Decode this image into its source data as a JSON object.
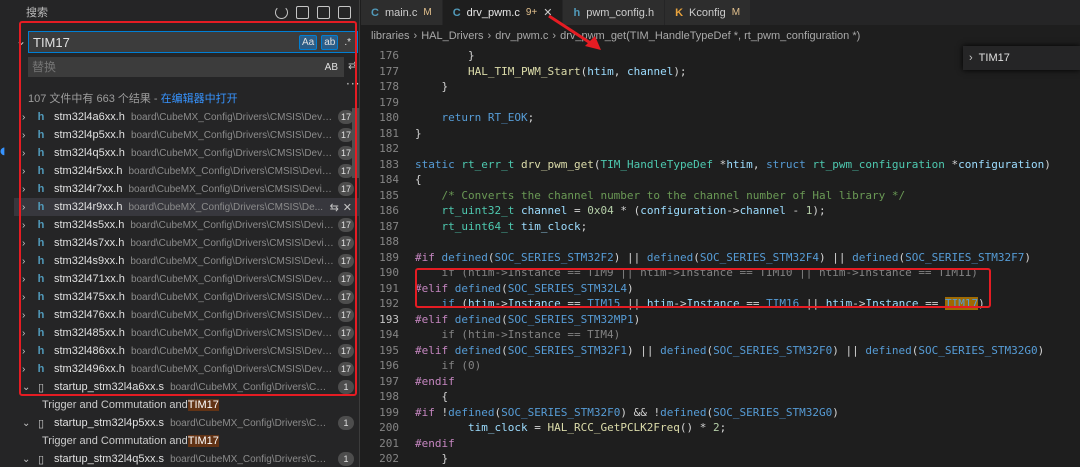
{
  "sidebar": {
    "title": "搜索",
    "search_value": "TIM17",
    "opt_case": "Aa",
    "opt_word": "ab",
    "opt_regex": ".*",
    "replace_placeholder": "替换",
    "opt_preserve_case": "AB",
    "summary": "107 文件中有 663 个结果 - ",
    "open_in_editor": "在编辑器中打开",
    "results": [
      {
        "name": "stm32l4a6xx.h",
        "path": "board\\CubeMX_Config\\Drivers\\CMSIS\\Device\\...",
        "count": "17",
        "icon": "h"
      },
      {
        "name": "stm32l4p5xx.h",
        "path": "board\\CubeMX_Config\\Drivers\\CMSIS\\Device\\...",
        "count": "17",
        "icon": "h"
      },
      {
        "name": "stm32l4q5xx.h",
        "path": "board\\CubeMX_Config\\Drivers\\CMSIS\\Device\\...",
        "count": "17",
        "icon": "h"
      },
      {
        "name": "stm32l4r5xx.h",
        "path": "board\\CubeMX_Config\\Drivers\\CMSIS\\Device\\...",
        "count": "17",
        "icon": "h"
      },
      {
        "name": "stm32l4r7xx.h",
        "path": "board\\CubeMX_Config\\Drivers\\CMSIS\\Device\\...",
        "count": "17",
        "icon": "h"
      },
      {
        "name": "stm32l4r9xx.h",
        "path": "board\\CubeMX_Config\\Drivers\\CMSIS\\De...",
        "count": "",
        "icon": "h"
      },
      {
        "name": "stm32l4s5xx.h",
        "path": "board\\CubeMX_Config\\Drivers\\CMSIS\\Device\\...",
        "count": "17",
        "icon": "h"
      },
      {
        "name": "stm32l4s7xx.h",
        "path": "board\\CubeMX_Config\\Drivers\\CMSIS\\Device\\...",
        "count": "17",
        "icon": "h"
      },
      {
        "name": "stm32l4s9xx.h",
        "path": "board\\CubeMX_Config\\Drivers\\CMSIS\\Device\\...",
        "count": "17",
        "icon": "h"
      },
      {
        "name": "stm32l471xx.h",
        "path": "board\\CubeMX_Config\\Drivers\\CMSIS\\Device\\...",
        "count": "17",
        "icon": "h"
      },
      {
        "name": "stm32l475xx.h",
        "path": "board\\CubeMX_Config\\Drivers\\CMSIS\\Device\\...",
        "count": "17",
        "icon": "h"
      },
      {
        "name": "stm32l476xx.h",
        "path": "board\\CubeMX_Config\\Drivers\\CMSIS\\Device\\...",
        "count": "17",
        "icon": "h"
      },
      {
        "name": "stm32l485xx.h",
        "path": "board\\CubeMX_Config\\Drivers\\CMSIS\\Device\\...",
        "count": "17",
        "icon": "h"
      },
      {
        "name": "stm32l486xx.h",
        "path": "board\\CubeMX_Config\\Drivers\\CMSIS\\Device\\...",
        "count": "17",
        "icon": "h"
      },
      {
        "name": "stm32l496xx.h",
        "path": "board\\CubeMX_Config\\Drivers\\CMSIS\\Device\\...",
        "count": "17",
        "icon": "h"
      }
    ],
    "results_s": [
      {
        "name": "startup_stm32l4a6xx.s",
        "path": "board\\CubeMX_Config\\Drivers\\CMSIS\\...",
        "count": "1",
        "match_pre": "Trigger and Commutation and ",
        "match_hl": "TIM17"
      },
      {
        "name": "startup_stm32l4p5xx.s",
        "path": "board\\CubeMX_Config\\Drivers\\CMSIS...",
        "count": "1",
        "match_pre": "Trigger and Commutation and ",
        "match_hl": "TIM17"
      },
      {
        "name": "startup_stm32l4q5xx.s",
        "path": "board\\CubeMX_Config\\Drivers\\CMSIS...",
        "count": "1"
      }
    ]
  },
  "editor": {
    "tabs": [
      {
        "icon": "C",
        "label": "main.c",
        "mod": "M",
        "close": ""
      },
      {
        "icon": "C",
        "label": "drv_pwm.c",
        "mod": "9+",
        "close": "✕"
      },
      {
        "icon": "h",
        "label": "pwm_config.h",
        "mod": "",
        "close": ""
      },
      {
        "icon": "K",
        "label": "Kconfig",
        "mod": "M",
        "close": ""
      }
    ],
    "breadcrumb": [
      "libraries",
      "HAL_Drivers",
      "drv_pwm.c",
      "drv_pwm_get(TIM_HandleTypeDef *, rt_pwm_configuration *)"
    ],
    "find_value": "TIM17",
    "line_numbers": [
      "176",
      "177",
      "178",
      "179",
      "180",
      "181",
      "182",
      "183",
      "184",
      "185",
      "186",
      "187",
      "188",
      "189",
      "190",
      "191",
      "192",
      "193",
      "194",
      "195",
      "196",
      "197",
      "198",
      "199",
      "200",
      "201",
      "202"
    ]
  }
}
